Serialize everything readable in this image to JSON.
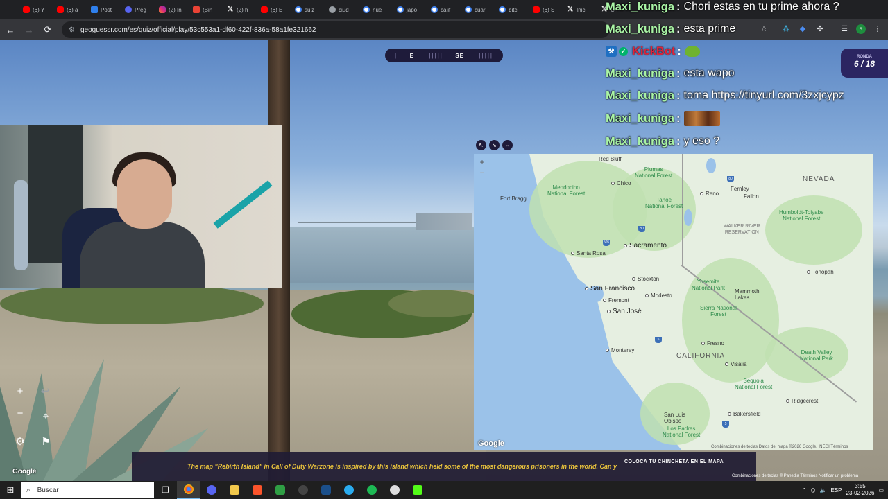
{
  "browser": {
    "tabs": [
      {
        "label": "(6) Y",
        "icon": "youtube-icon",
        "kind": "yt"
      },
      {
        "label": "(6) a",
        "icon": "youtube-icon",
        "kind": "yt"
      },
      {
        "label": "Post",
        "icon": "bing-icon",
        "kind": "bi"
      },
      {
        "label": "Preg",
        "icon": "discord-icon",
        "kind": "di"
      },
      {
        "label": "(2) In",
        "icon": "instagram-icon",
        "kind": "ig"
      },
      {
        "label": "(Bin",
        "icon": "gmail-icon",
        "kind": "gm"
      },
      {
        "label": "(2) h",
        "icon": "x-icon",
        "kind": "x"
      },
      {
        "label": "(6) E",
        "icon": "youtube-icon",
        "kind": "yt"
      },
      {
        "label": "suiz",
        "icon": "google-icon",
        "kind": "g"
      },
      {
        "label": "ciud",
        "icon": "globe-icon",
        "kind": "gr"
      },
      {
        "label": "nue",
        "icon": "google-icon",
        "kind": "g"
      },
      {
        "label": "japo",
        "icon": "google-icon",
        "kind": "g"
      },
      {
        "label": "calif",
        "icon": "google-icon",
        "kind": "g"
      },
      {
        "label": "cuar",
        "icon": "google-icon",
        "kind": "g"
      },
      {
        "label": "bitc",
        "icon": "google-icon",
        "kind": "g"
      },
      {
        "label": "(6) S",
        "icon": "youtube-icon",
        "kind": "yt"
      },
      {
        "label": "Inic",
        "icon": "x-icon",
        "kind": "x"
      },
      {
        "label": "Ch",
        "icon": "x-icon",
        "kind": "x"
      }
    ],
    "url": "geoguessr.com/es/quiz/official/play/53c553a1-df60-422f-836a-58a1fe321662"
  },
  "game": {
    "compass": {
      "left": "E",
      "right": "SE"
    },
    "round": {
      "label": "RONDA",
      "value": "6 / 18"
    },
    "sv_google": "Google",
    "fact": "The map \"Rebirth Island\" in Call of Duty Warzone is inspired by this island which held some of the most dangerous prisoners in the world. Can you guess where it is?",
    "guess_label": "COLOCA TU CHINCHETA EN EL MAPA",
    "footer": "Combinaciones de teclas  © Panedia  Términos  Notificar un problema"
  },
  "chat": [
    {
      "user": "Maxi_kuniga",
      "msg": "Chori estas en tu prime ahora ?"
    },
    {
      "user": "Maxi_kuniga",
      "msg": "esta prime"
    },
    {
      "user": "KickBot",
      "msg": "",
      "emote": "frog-emote"
    },
    {
      "user": "Maxi_kuniga",
      "msg": "esta wapo"
    },
    {
      "user": "Maxi_kuniga",
      "msg": "toma https://tinyurl.com/3zxjcypz"
    },
    {
      "user": "Maxi_kuniga",
      "msg": "",
      "emote": "image-emote"
    },
    {
      "user": "Maxi_kuniga",
      "msg": "y eso ?"
    }
  ],
  "map": {
    "labels": {
      "red_bluff": "Red Bluff",
      "chico": "Chico",
      "plumas": "Plumas\nNational Forest",
      "mendocino": "Mendocino\nNational Forest",
      "tahoe": "Tahoe\nNational Forest",
      "reno": "Reno",
      "fernley": "Fernley",
      "fallon": "Fallon",
      "nevada": "NEVADA",
      "fort_bragg": "Fort Bragg",
      "humboldt": "Humboldt-Toiyabe\nNational Forest",
      "walker": "WALKER RIVER\nRESERVATION",
      "sacramento": "Sacramento",
      "santa_rosa": "Santa Rosa",
      "tonopah": "Tonopah",
      "stockton": "Stockton",
      "san_francisco": "San Francisco",
      "yosemite": "Yosemite\nNational Park",
      "mammoth": "Mammoth\nLakes",
      "fremont": "Fremont",
      "modesto": "Modesto",
      "san_jose": "San José",
      "sierra": "Sierra National\nForest",
      "fresno": "Fresno",
      "monterey": "Monterey",
      "california": "CALIFORNIA",
      "death_valley": "Death Valley\nNational Park",
      "visalia": "Visalia",
      "sequoia": "Sequoia\nNational Forest",
      "ridgecrest": "Ridgecrest",
      "san_luis": "San Luis\nObispo",
      "bakersfield": "Bakersfield",
      "los_padres": "Los Padres\nNational Forest"
    },
    "google": "Google",
    "attr": "Combinaciones de teclas   Datos del mapa ©2026 Google, INEGI   Términos"
  },
  "taskbar": {
    "search_placeholder": "Buscar",
    "lang": "ESP",
    "time": "3:55",
    "date": "23-02-2026"
  }
}
